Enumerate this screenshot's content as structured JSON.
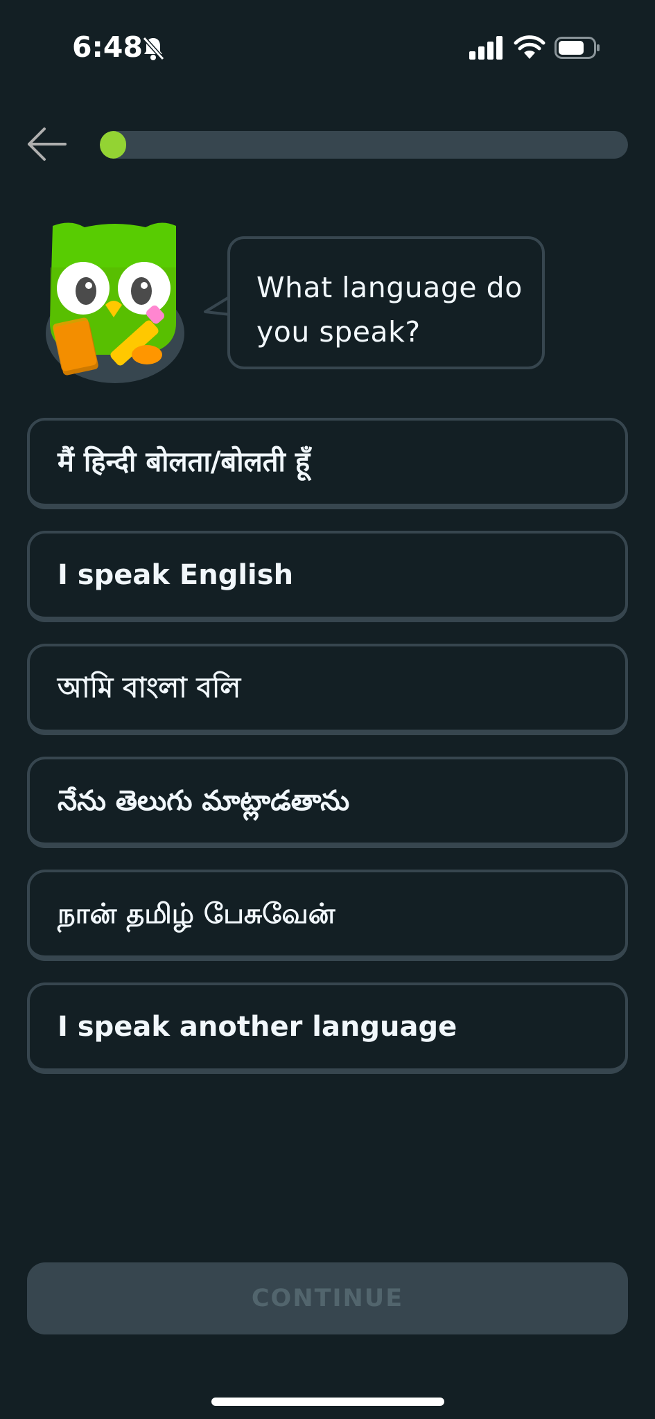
{
  "status_bar": {
    "time": "6:48",
    "icons": [
      "bell-slash-icon",
      "cellular-signal-icon",
      "wifi-icon",
      "battery-icon"
    ]
  },
  "header": {
    "back_icon": "arrow-left-icon",
    "progress_percent": 5
  },
  "mascot": {
    "icon": "owl-mascot",
    "prompt": "What language do you speak?"
  },
  "options": [
    {
      "label": "मैं हिन्दी बोलता/बोलती हूँ"
    },
    {
      "label": "I speak English"
    },
    {
      "label": "আমি বাংলা বলি"
    },
    {
      "label": "నేను తెలుగు మాట్లాడతాను"
    },
    {
      "label": "நான் தமிழ் பேசுவேன்"
    },
    {
      "label": "I speak another language"
    }
  ],
  "continue_button": {
    "label": "CONTINUE",
    "enabled": false
  },
  "colors": {
    "background": "#131f24",
    "border": "#37464f",
    "progress_fill": "#93d333",
    "owl_green": "#58cc02",
    "button_disabled_text": "#52656d"
  }
}
